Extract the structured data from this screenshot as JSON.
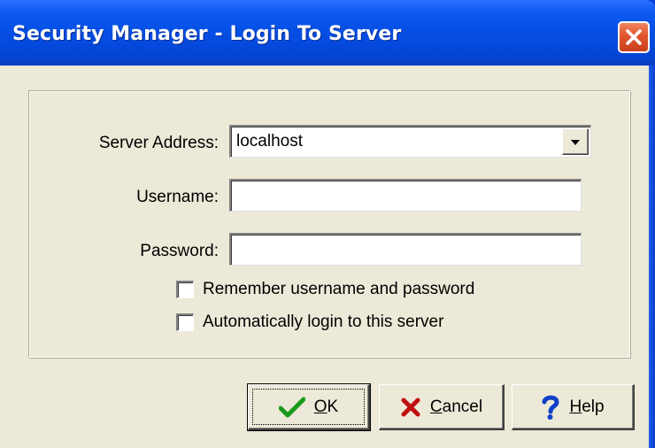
{
  "window": {
    "title": "Security Manager - Login To Server"
  },
  "form": {
    "server_address_label": "Server Address:",
    "server_address_value": "localhost",
    "username_label": "Username:",
    "username_value": "",
    "password_label": "Password:",
    "password_value": "",
    "remember_label": "Remember username and password",
    "remember_checked": false,
    "autologin_label": "Automatically login to this server",
    "autologin_checked": false
  },
  "buttons": {
    "ok": {
      "first": "O",
      "rest": "K"
    },
    "cancel": {
      "first": "C",
      "rest": "ancel"
    },
    "help": {
      "first": "H",
      "rest": "elp"
    }
  },
  "icons": {
    "close": "close-icon",
    "dropdown": "chevron-down-icon",
    "ok": "checkmark-icon",
    "cancel": "x-icon",
    "help": "question-mark-icon"
  },
  "colors": {
    "titlebar": "#0650e6",
    "close_button": "#e0542d",
    "dialog_face": "#ece9d8",
    "ok_icon": "#1a9a1a",
    "cancel_icon": "#c01010",
    "help_icon": "#1040c8"
  }
}
